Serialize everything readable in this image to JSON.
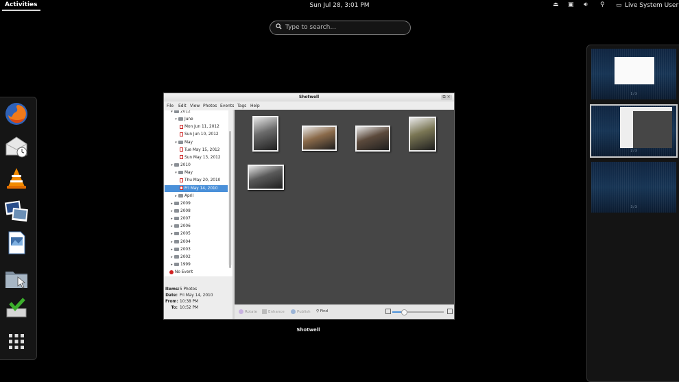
{
  "topbar": {
    "activities": "Activities",
    "clock": "Sun Jul 28,  3:01 PM",
    "user": "Live System User"
  },
  "search": {
    "placeholder": "Type to search..."
  },
  "dash": {
    "items": [
      "firefox-icon",
      "mail-clock-icon",
      "vlc-icon",
      "shotwell-icon",
      "document-viewer-icon",
      "file-manager-icon",
      "software-installer-icon",
      "app-grid-icon"
    ]
  },
  "workspaces": [
    {
      "label": "1 / 3"
    },
    {
      "label": "2 / 3"
    },
    {
      "label": "3 / 3"
    }
  ],
  "window": {
    "title": "Shotwell",
    "label": "Shotwell",
    "menu": [
      "File",
      "Edit",
      "View",
      "Photos",
      "Events",
      "Tags",
      "Help"
    ],
    "tree": [
      {
        "text": "2012",
        "type": "folder",
        "level": 1,
        "expander": "▾"
      },
      {
        "text": "June",
        "type": "folder",
        "level": 2,
        "expander": "▾"
      },
      {
        "text": "Mon Jun 11, 2012",
        "type": "event",
        "level": 3
      },
      {
        "text": "Sun Jun 10, 2012",
        "type": "event",
        "level": 3
      },
      {
        "text": "May",
        "type": "folder",
        "level": 2,
        "expander": "▾"
      },
      {
        "text": "Tue May 15, 2012",
        "type": "event",
        "level": 3
      },
      {
        "text": "Sun May 13, 2012",
        "type": "event",
        "level": 3
      },
      {
        "text": "2010",
        "type": "folder",
        "level": 1,
        "expander": "▾"
      },
      {
        "text": "May",
        "type": "folder",
        "level": 2,
        "expander": "▾"
      },
      {
        "text": "Thu May 20, 2010",
        "type": "event",
        "level": 3
      },
      {
        "text": "Fri May 14, 2010",
        "type": "event",
        "level": 3,
        "selected": true
      },
      {
        "text": "April",
        "type": "folder",
        "level": 2,
        "expander": "▸"
      },
      {
        "text": "2009",
        "type": "folder",
        "level": 1,
        "expander": "▸"
      },
      {
        "text": "2008",
        "type": "folder",
        "level": 1,
        "expander": "▸"
      },
      {
        "text": "2007",
        "type": "folder",
        "level": 1,
        "expander": "▸"
      },
      {
        "text": "2006",
        "type": "folder",
        "level": 1,
        "expander": "▸"
      },
      {
        "text": "2005",
        "type": "folder",
        "level": 1,
        "expander": "▸"
      },
      {
        "text": "2004",
        "type": "folder",
        "level": 1,
        "expander": "▸"
      },
      {
        "text": "2003",
        "type": "folder",
        "level": 1,
        "expander": "▸"
      },
      {
        "text": "2002",
        "type": "folder",
        "level": 1,
        "expander": "▸"
      },
      {
        "text": "1999",
        "type": "folder",
        "level": 1,
        "expander": "▸"
      },
      {
        "text": "No Event",
        "type": "noevent",
        "level": 1
      }
    ],
    "info": [
      {
        "key": "Items:",
        "value": "5 Photos"
      },
      {
        "key": "Date:",
        "value": "Fri May 14, 2010"
      },
      {
        "key": "From:",
        "value": "10:38 PM"
      },
      {
        "key": "To:",
        "value": "10:52 PM"
      }
    ],
    "photos": [
      {
        "name": "photo-wedding-couple",
        "tone": "#6b6b6b"
      },
      {
        "name": "photo-family-group",
        "tone": "#8a6a4a"
      },
      {
        "name": "photo-bride-groom",
        "tone": "#5c4a3c"
      },
      {
        "name": "photo-outdoor-family",
        "tone": "#7a7654"
      },
      {
        "name": "photo-group-table",
        "tone": "#5a5a5a"
      }
    ],
    "toolbar": {
      "rotate": "Rotate",
      "enhance": "Enhance",
      "publish": "Publish",
      "find": "Find"
    },
    "zoom_level": 0.22
  },
  "colors": {
    "selection": "#4a90d9",
    "desktop": "#000000"
  }
}
